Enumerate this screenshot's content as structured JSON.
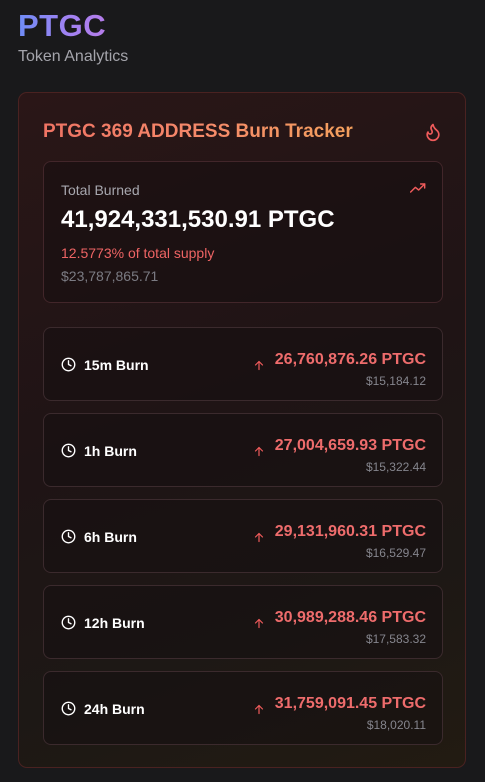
{
  "header": {
    "title": "PTGC",
    "subtitle": "Token Analytics"
  },
  "tracker": {
    "title": "PTGC 369 ADDRESS Burn Tracker",
    "title_icon": "flame-icon",
    "total": {
      "label": "Total Burned",
      "value": "41,924,331,530.91 PTGC",
      "percent": "12.5773% of total supply",
      "usd": "$23,787,865.71",
      "trend_icon": "trending-up-icon"
    },
    "rows": [
      {
        "label": "15m Burn",
        "amount": "26,760,876.26 PTGC",
        "usd": "$15,184.12"
      },
      {
        "label": "1h Burn",
        "amount": "27,004,659.93 PTGC",
        "usd": "$15,322.44"
      },
      {
        "label": "6h Burn",
        "amount": "29,131,960.31 PTGC",
        "usd": "$16,529.47"
      },
      {
        "label": "12h Burn",
        "amount": "30,989,288.46 PTGC",
        "usd": "$17,583.32"
      },
      {
        "label": "24h Burn",
        "amount": "31,759,091.45 PTGC",
        "usd": "$18,020.11"
      }
    ]
  },
  "colors": {
    "background": "#19191b",
    "accent_red": "#ee6c6c",
    "title_gradient_start": "#6f8cf6",
    "title_gradient_end": "#b57cea",
    "card_title_gradient_start": "#f07464",
    "card_title_gradient_end": "#f4a05d"
  }
}
